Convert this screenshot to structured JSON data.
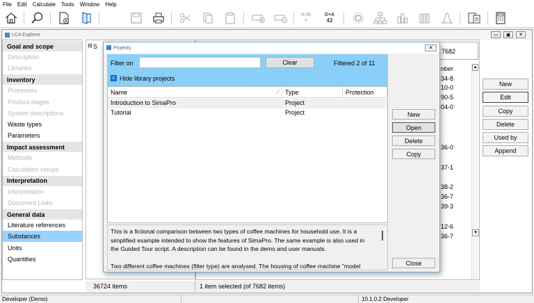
{
  "menu": [
    "File",
    "Edit",
    "Calculate",
    "Tools",
    "Window",
    "Help"
  ],
  "toolbar": {
    "ab_top": "A+B",
    "ab_bottom": "=",
    "da_top": "D+A",
    "da_bottom": "42"
  },
  "window": {
    "title": "LCA Explorer"
  },
  "sidebar": {
    "sections": [
      {
        "heading": "Goal and scope",
        "items": [
          {
            "label": "Description",
            "disabled": true
          },
          {
            "label": "Libraries",
            "disabled": true
          }
        ]
      },
      {
        "heading": "Inventory",
        "items": [
          {
            "label": "Processes",
            "disabled": true
          },
          {
            "label": "Product stages",
            "disabled": true
          },
          {
            "label": "System descriptions",
            "disabled": true
          },
          {
            "label": "Waste types",
            "disabled": false
          },
          {
            "label": "Parameters",
            "disabled": false
          }
        ]
      },
      {
        "heading": "Impact assessment",
        "items": [
          {
            "label": "Methods",
            "disabled": true
          },
          {
            "label": "Calculation setups",
            "disabled": true
          }
        ]
      },
      {
        "heading": "Interpretation",
        "items": [
          {
            "label": "Interpretation",
            "disabled": true
          },
          {
            "label": "Document Links",
            "disabled": true
          }
        ]
      },
      {
        "heading": "General data",
        "items": [
          {
            "label": "Literature references",
            "disabled": false
          },
          {
            "label": "Substances",
            "disabled": false,
            "selected": true
          },
          {
            "label": "Units",
            "disabled": false
          },
          {
            "label": "Quantities",
            "disabled": false
          }
        ]
      }
    ]
  },
  "background": {
    "count_partial": "7682",
    "column_partial": "nber",
    "left_letter": "S",
    "numbers": [
      "34-8",
      "10-0",
      "90-5",
      "04-0",
      "36-0",
      "37-1",
      "38-2",
      "36-7",
      "39-3",
      "12-6",
      "36-7"
    ]
  },
  "right_buttons": [
    "New",
    "Edit",
    "Copy",
    "Delete",
    "Used by",
    "Append"
  ],
  "status": {
    "left_count": "36724 items",
    "selection": "1 item selected (of 7682 items)",
    "user": "Developer (Demo)",
    "version": "10.1.0.2 Developer"
  },
  "dialog": {
    "title": "Projects",
    "close_glyph": "✕",
    "filter_label": "Filter on",
    "filter_value": "",
    "clear_label": "Clear",
    "filtered_text": "Filtered 2 of 11",
    "hide_library_label": "Hide library projects",
    "hide_library_checked": true,
    "columns": [
      "Name",
      "Type",
      "Protection"
    ],
    "rows": [
      {
        "name": "Introduction to SimaPro",
        "type": "Project",
        "protection": ""
      },
      {
        "name": "Tutorial",
        "type": "Project",
        "protection": ""
      }
    ],
    "buttons": {
      "new": "New",
      "open": "Open",
      "delete": "Delete",
      "copy": "Copy",
      "close": "Close"
    },
    "description_lines": [
      "This is a fictional comparison between two types of coffee machines for household use. It is a",
      "simplified example intended to show the features of SimaPro. The same example is also used in",
      "the Guided Tour script. A description can be found in the demo and user manuals.",
      "",
      "Two different coffee machines (filter type) are analysed. The housing of coffee machine \"model"
    ]
  }
}
